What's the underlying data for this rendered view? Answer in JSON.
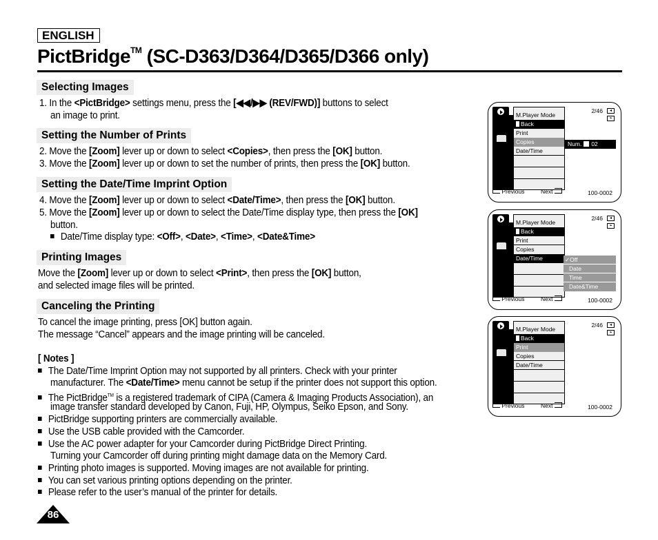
{
  "language_label": "ENGLISH",
  "title": {
    "main": "PictBridge",
    "tm": "TM",
    "rest": " (SC-D363/D364/D365/D366 only)"
  },
  "sections": {
    "selecting": {
      "heading": "Selecting Images",
      "step1": {
        "n": "1. In the ",
        "b1": "<PictBridge>",
        "t2": " settings menu, press the ",
        "b2": "[◀◀/▶▶ (REV/FWD)]",
        "t3": " buttons to select",
        "line2": "an image to print."
      }
    },
    "number": {
      "heading": "Setting the Number of Prints",
      "step2": {
        "t1": "2. Move the ",
        "b1": "[Zoom]",
        "t2": " lever up or down to select ",
        "b2": "<Copies>",
        "t3": ", then press the ",
        "b3": "[OK]",
        "t4": " button."
      },
      "step3": {
        "t1": "3. Move the ",
        "b1": "[Zoom]",
        "t2": " lever up or down to set the number of prints, then press the ",
        "b2": "[OK]",
        "t3": " button."
      }
    },
    "datetime": {
      "heading": "Setting the Date/Time Imprint Option",
      "step4": {
        "t1": "4. Move the ",
        "b1": "[Zoom]",
        "t2": " lever up or down to select ",
        "b2": "<Date/Time>",
        "t3": ", then press the ",
        "b3": "[OK]",
        "t4": " button."
      },
      "step5": {
        "t1": "5. Move the ",
        "b1": "[Zoom]",
        "t2": " lever up or down to select the Date/Time display type, then press the ",
        "b2": "[OK]",
        "line2": "button."
      },
      "types": {
        "t1": "Date/Time display type: ",
        "o1": "<Off>",
        "o2": "<Date>",
        "o3": "<Time>",
        "o4": "<Date&Time>",
        "sep": ", "
      }
    },
    "printing": {
      "heading": "Printing Images",
      "t1": "Move the ",
      "b1": "[Zoom]",
      "t2": " lever up or down to select ",
      "b2": "<Print>",
      "t3": ", then press the ",
      "b3": "[OK]",
      "t4": " button,",
      "line2": "and selected image files will be printed."
    },
    "canceling": {
      "heading": "Canceling the Printing",
      "line1": "To cancel the image printing, press [OK] button again.",
      "line2": "The message “Cancel” appears and the image printing will be canceled."
    }
  },
  "notes": {
    "heading": "[ Notes ]",
    "n1": {
      "l1": "The Date/Time Imprint Option may not supported by all printers. Check with your printer",
      "l2a": "manufacturer. The ",
      "l2b": "<Date/Time>",
      "l2c": " menu cannot be setup if the printer does not support this option."
    },
    "n2": {
      "l1a": "The PictBridge",
      "tm": "TM",
      "l1b": " is a registered trademark of CIPA (Camera & Imaging Products Association), an",
      "l2": "image transfer standard developed by Canon, Fuji, HP, Olympus, Seiko Epson, and Sony."
    },
    "n3": "PictBridge supporting printers are commercially available.",
    "n4": "Use the USB cable provided with the Camcorder.",
    "n5": {
      "l1": "Use the AC power adapter for your Camcorder during PictBridge Direct Printing.",
      "l2": "Turning your Camcorder off during printing might damage data on the Memory Card."
    },
    "n6": "Printing photo images is supported. Moving images are not available for printing.",
    "n7": "You can set various printing options depending on the printer.",
    "n8": "Please refer to the user’s manual of the printer for details."
  },
  "page_number": "86",
  "screens": {
    "mode": "M.Player Mode",
    "items": [
      "Back",
      "Print",
      "Copies",
      "Date/Time"
    ],
    "counter": "2/46",
    "previous": "Previous",
    "next": "Next",
    "file_id": "100-0002",
    "num_label": "Num.",
    "num_value": "02",
    "datetime_options": [
      "Off",
      "Date",
      "Time",
      "Date&Time"
    ],
    "check": "✓"
  }
}
